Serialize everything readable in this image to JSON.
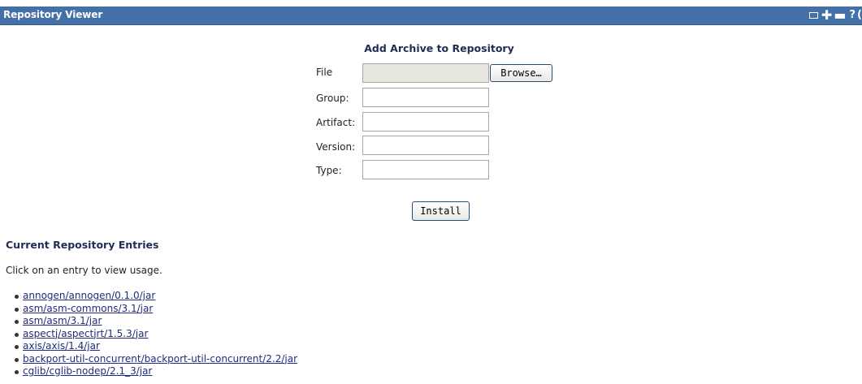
{
  "window": {
    "title": "Repository Viewer",
    "controls": {
      "help": "?"
    }
  },
  "form": {
    "title": "Add Archive to Repository",
    "fields": {
      "file": {
        "label": "File",
        "value": ""
      },
      "group": {
        "label": "Group:",
        "value": ""
      },
      "artifact": {
        "label": "Artifact:",
        "value": ""
      },
      "version": {
        "label": "Version:",
        "value": ""
      },
      "type": {
        "label": "Type:",
        "value": ""
      }
    },
    "browse_label": "Browse…",
    "install_label": "Install"
  },
  "entries_section": {
    "title": "Current Repository Entries",
    "hint": "Click on an entry to view usage.",
    "items": [
      "annogen/annogen/0.1.0/jar",
      "asm/asm-commons/3.1/jar",
      "asm/asm/3.1/jar",
      "aspectj/aspectjrt/1.5.3/jar",
      "axis/axis/1.4/jar",
      "backport-util-concurrent/backport-util-concurrent/2.2/jar",
      "cglib/cglib-nodep/2.1_3/jar"
    ]
  }
}
